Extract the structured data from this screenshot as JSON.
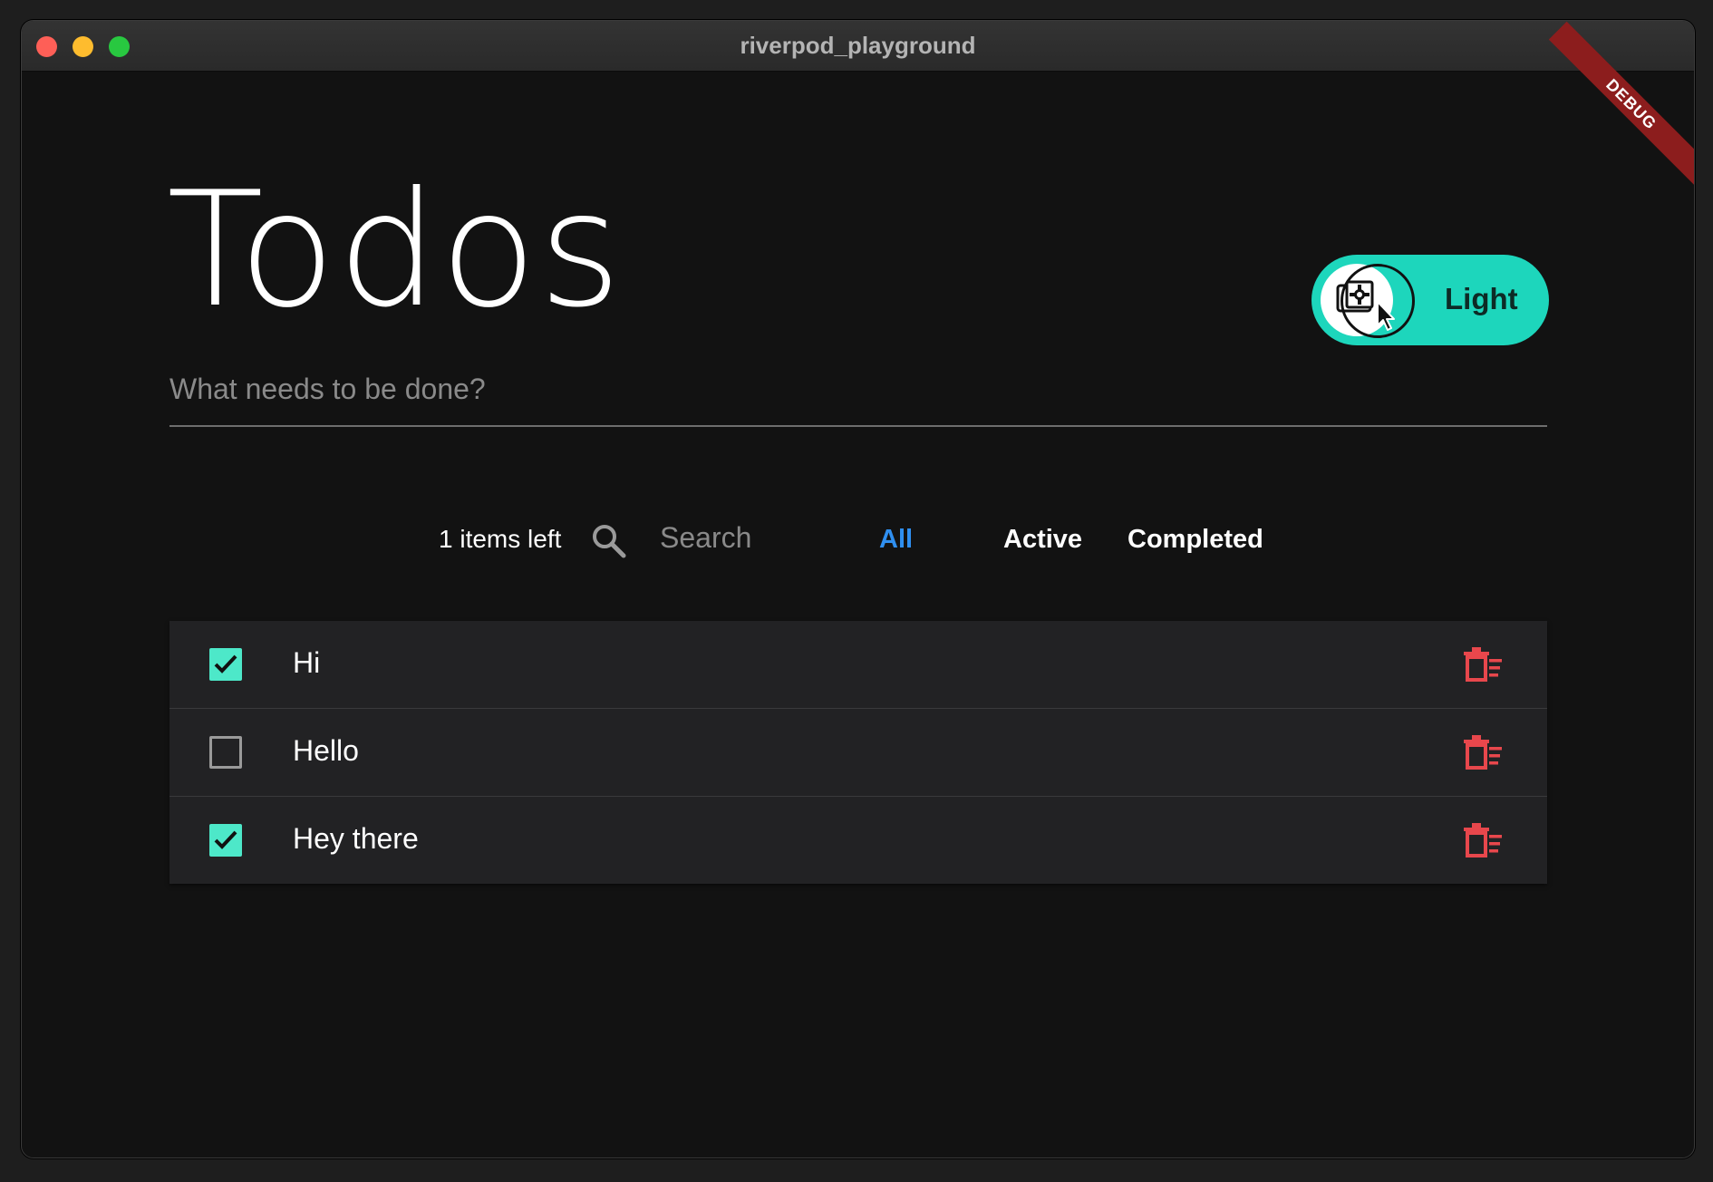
{
  "window": {
    "title": "riverpod_playground",
    "debug_banner": "DEBUG"
  },
  "header": {
    "title": "Todos",
    "theme_toggle": {
      "label": "Light",
      "icon": "brightness-auto-icon"
    }
  },
  "new_todo": {
    "placeholder": "What needs to be done?",
    "value": ""
  },
  "toolbar": {
    "items_left": "1 items left",
    "search": {
      "placeholder": "Search",
      "value": "",
      "icon": "search-icon"
    },
    "filters": [
      {
        "label": "All",
        "selected": true
      },
      {
        "label": "Active",
        "selected": false
      },
      {
        "label": "Completed",
        "selected": false
      }
    ]
  },
  "todos": [
    {
      "text": "Hi",
      "completed": true
    },
    {
      "text": "Hello",
      "completed": false
    },
    {
      "text": "Hey there",
      "completed": true
    }
  ],
  "colors": {
    "accent": "#1dd6bc",
    "checkbox_checked": "#4de8c9",
    "filter_selected": "#2f8ff0",
    "delete": "#e8474c",
    "background": "#121212"
  }
}
